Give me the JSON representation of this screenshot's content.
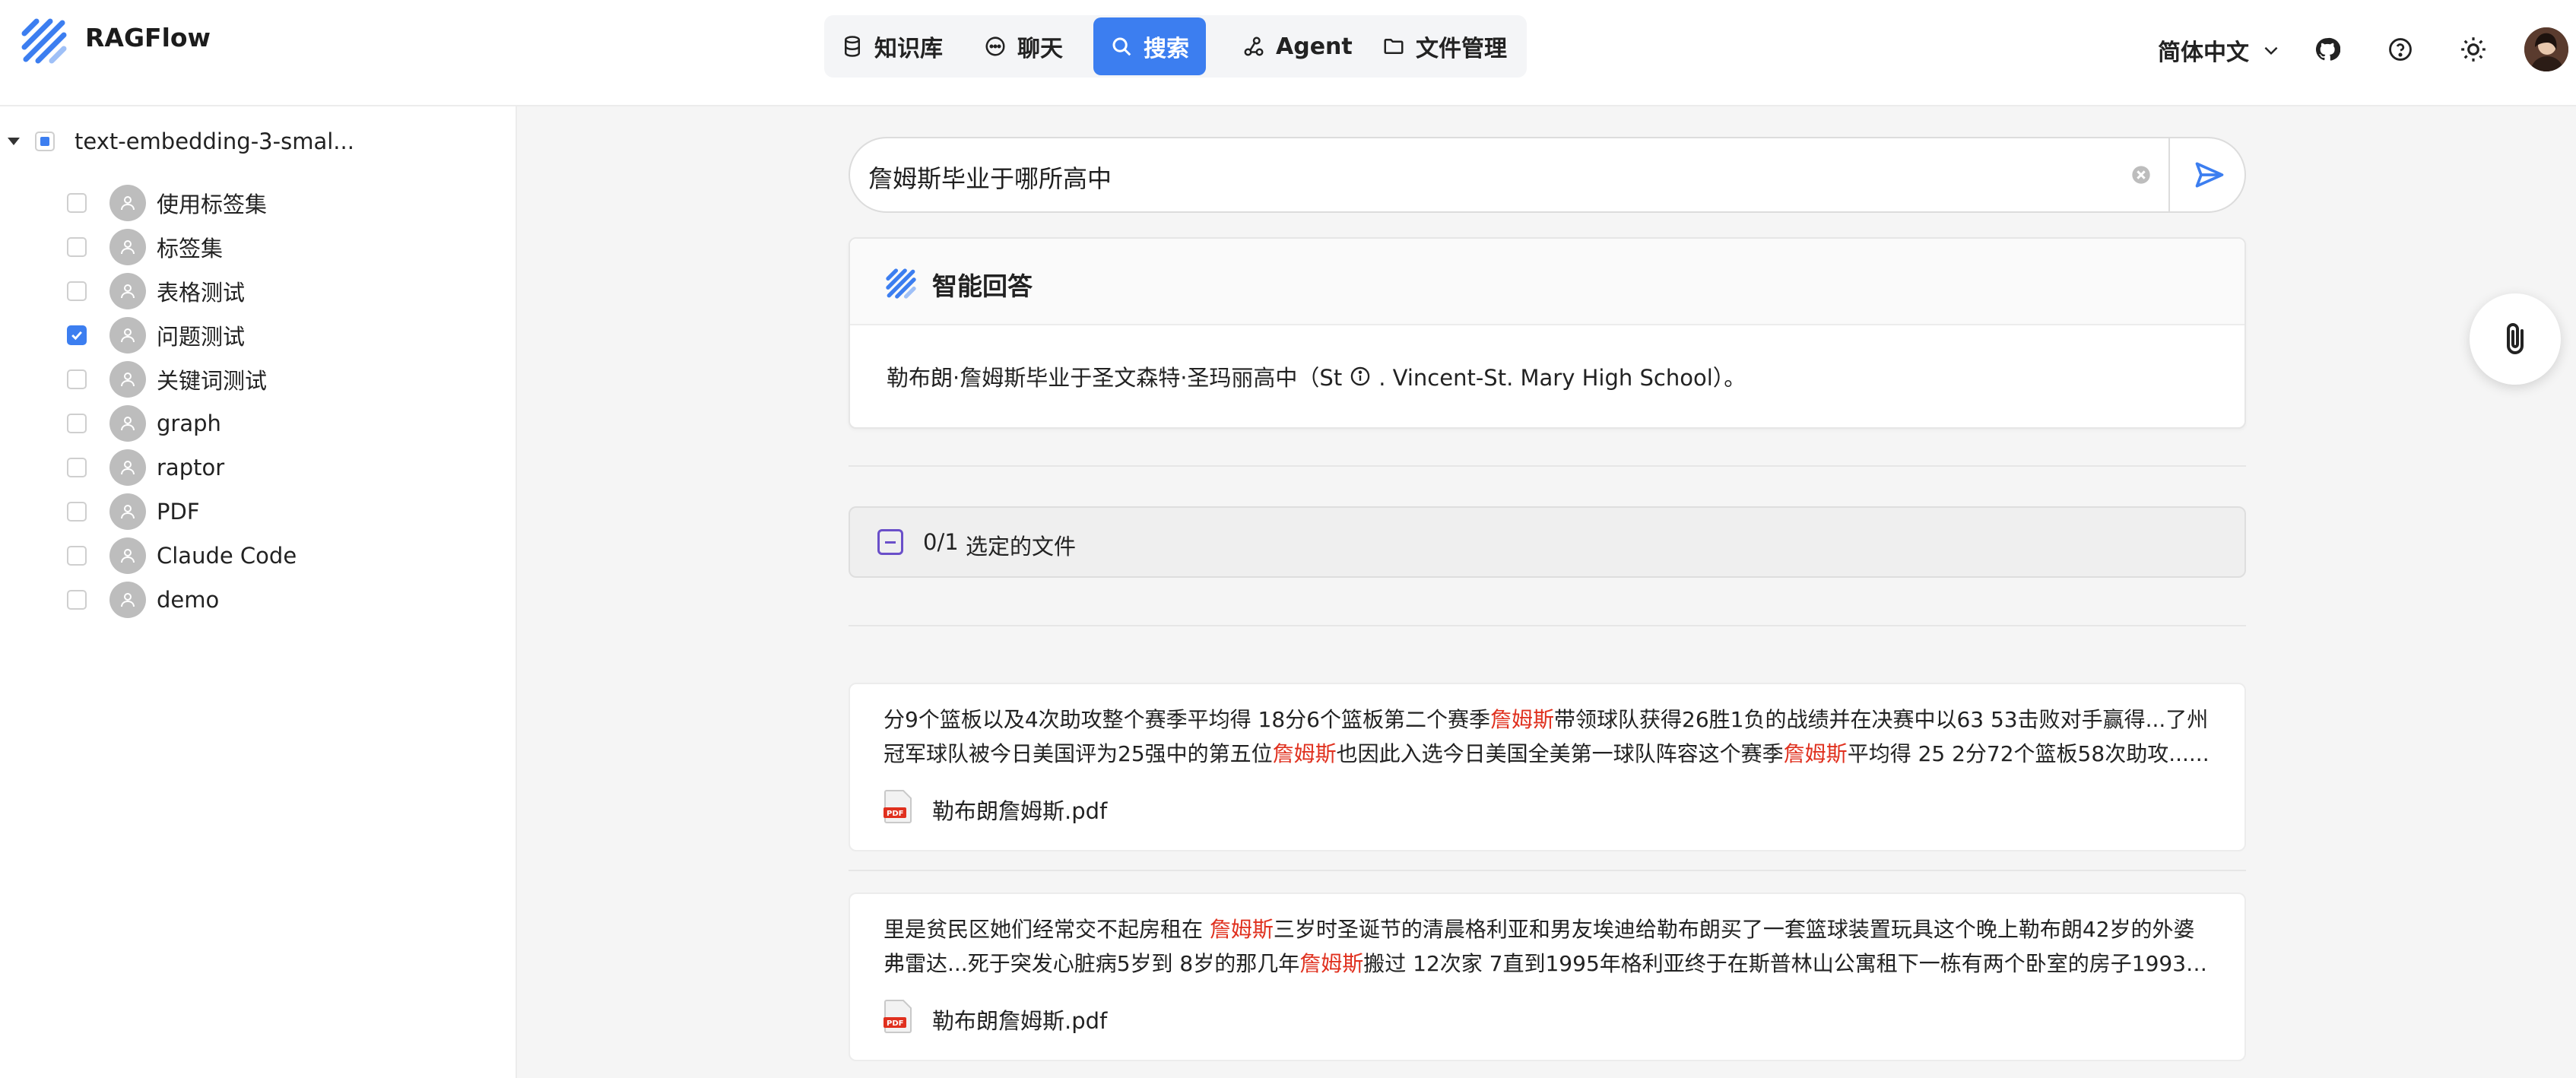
{
  "app": {
    "brand": "RAGFlow"
  },
  "nav": {
    "items": [
      {
        "label": "知识库",
        "icon": "database-icon"
      },
      {
        "label": "聊天",
        "icon": "chat-icon"
      },
      {
        "label": "搜索",
        "icon": "search-icon",
        "active": true
      },
      {
        "label": "Agent",
        "icon": "agent-graph-icon"
      },
      {
        "label": "文件管理",
        "icon": "folder-icon"
      }
    ]
  },
  "header": {
    "language": "简体中文"
  },
  "sidebar": {
    "root": {
      "label": "text-embedding-3-smal...",
      "state": "partial"
    },
    "items": [
      {
        "label": "使用标签集",
        "checked": false
      },
      {
        "label": "标签集",
        "checked": false
      },
      {
        "label": "表格测试",
        "checked": false
      },
      {
        "label": "问题测试",
        "checked": true
      },
      {
        "label": "关键词测试",
        "checked": false
      },
      {
        "label": "graph",
        "checked": false
      },
      {
        "label": "raptor",
        "checked": false
      },
      {
        "label": "PDF",
        "checked": false
      },
      {
        "label": "Claude Code",
        "checked": false
      },
      {
        "label": "demo",
        "checked": false
      }
    ]
  },
  "search": {
    "query": "詹姆斯毕业于哪所高中"
  },
  "answer": {
    "title": "智能回答",
    "text_before": "勒布朗·詹姆斯毕业于圣文森特·圣玛丽高中（St",
    "text_after": ". Vincent-St. Mary High School）。"
  },
  "files": {
    "count": "0/1",
    "label": "选定的文件"
  },
  "results": [
    {
      "line1": [
        {
          "t": "分9个篮板以及4次助攻整个赛季平均得 18分6个篮板第二个赛季"
        },
        {
          "t": "詹姆斯",
          "hl": true
        },
        {
          "t": "带领球队获得26胜1负的战绩并在决赛中以63 53击败对手赢得...了州"
        }
      ],
      "line2": [
        {
          "t": "冠军球队被今日美国评为25强中的第五位"
        },
        {
          "t": "詹姆斯",
          "hl": true
        },
        {
          "t": "也因此入选今日美国全美第一球队阵容这个赛季"
        },
        {
          "t": "詹姆斯",
          "hl": true
        },
        {
          "t": "平均得 25 2分72个篮板58次助攻......"
        }
      ],
      "file": "勒布朗詹姆斯.pdf"
    },
    {
      "line1": [
        {
          "t": "里是贫民区她们经常交不起房租在 "
        },
        {
          "t": "詹姆斯",
          "hl": true
        },
        {
          "t": "三岁时圣诞节的清晨格利亚和男友埃迪给勒布朗买了一套篮球装置玩具这个晚上勒布朗42岁的外婆"
        }
      ],
      "line2": [
        {
          "t": "弗雷达...死于突发心脏病5岁到 8岁的那几年"
        },
        {
          "t": "詹姆斯",
          "hl": true
        },
        {
          "t": "搬过 12次家 7直到1995年格利亚终于在斯普林山公寓租下一栋有两个卧室的房子1993年..."
        }
      ],
      "file": "勒布朗詹姆斯.pdf"
    }
  ],
  "colors": {
    "accent": "#3c7ef0",
    "highlight": "#e0301e",
    "selected_files_icon": "#6a4fc9"
  }
}
